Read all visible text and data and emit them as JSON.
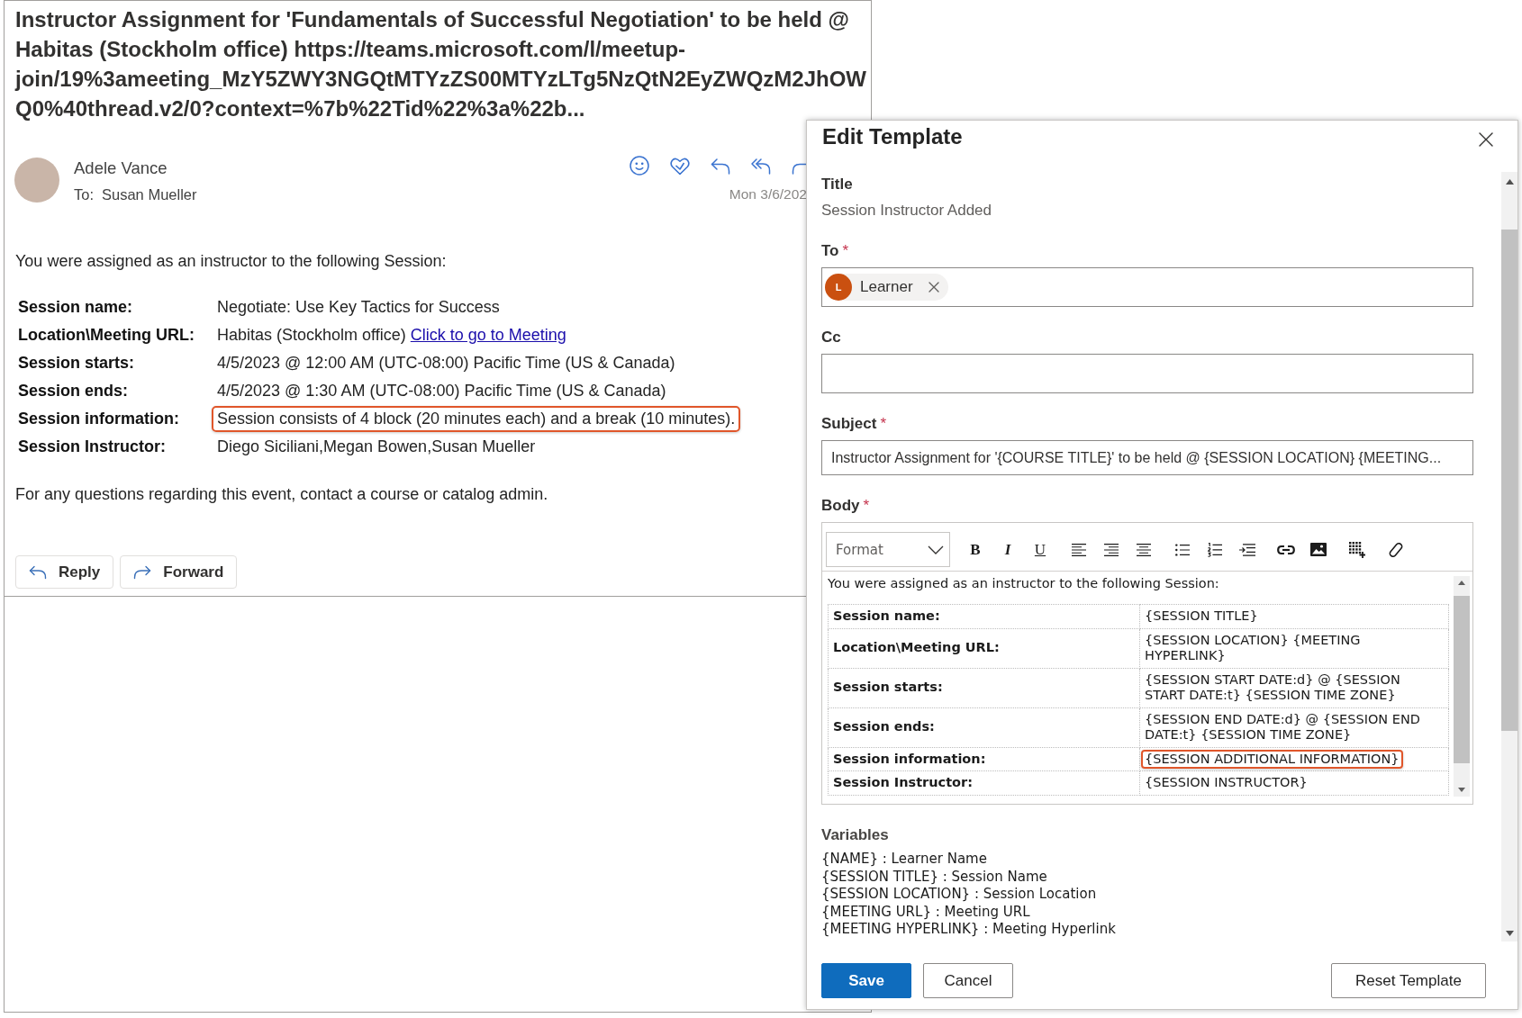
{
  "email": {
    "subject_lines": [
      "Instructor Assignment for 'Fundamentals of Successful Negotiation' to be held @",
      "Habitas (Stockholm office) https://teams.microsoft.com/l/meetup-",
      "join/19%3ameeting_MzY5ZWY3NGQtMTYzZS00MTYzLTg5NzQtN2EyZWQzM2JhOW",
      "Q0%40thread.v2/0?context=%7b%22Tid%22%3a%22b..."
    ],
    "sender": "Adele Vance",
    "to_label": "To:",
    "to": "Susan Mueller",
    "date": "Mon 3/6/202",
    "intro": "You were assigned as an instructor to the following Session:",
    "rows": [
      {
        "label": "Session name:",
        "value": "Negotiate: Use Key Tactics for Success",
        "highlighted": false
      },
      {
        "label": "Location\\Meeting URL:",
        "value": "Habitas (Stockholm office)",
        "link": "Click to go to Meeting",
        "highlighted": false
      },
      {
        "label": "Session starts:",
        "value": "4/5/2023 @ 12:00 AM (UTC-08:00) Pacific Time (US & Canada)",
        "highlighted": false
      },
      {
        "label": "Session ends:",
        "value": "4/5/2023 @ 1:30 AM (UTC-08:00) Pacific Time (US & Canada)",
        "highlighted": false
      },
      {
        "label": "Session information:",
        "value": "Session consists of 4 block (20 minutes each) and a break (10 minutes).",
        "highlighted": true
      },
      {
        "label": "Session Instructor:",
        "value": "Diego Siciliani,Megan Bowen,Susan Mueller",
        "highlighted": false
      }
    ],
    "closing": "For any questions regarding this event, contact a course or catalog admin.",
    "actions": [
      {
        "kind": "reply",
        "label": "Reply"
      },
      {
        "kind": "forward",
        "label": "Forward"
      }
    ]
  },
  "edit_template": {
    "title": "Edit Template",
    "title_field": {
      "label": "Title",
      "value": "Session Instructor Added"
    },
    "to": {
      "label": "To",
      "required_mark": "*",
      "recipients": [
        {
          "initials": "L",
          "name": "Learner"
        }
      ]
    },
    "cc": {
      "label": "Cc"
    },
    "subject": {
      "label": "Subject",
      "required_mark": "*",
      "value": "Instructor Assignment for '{COURSE TITLE}' to be held @ {SESSION LOCATION} {MEETING..."
    },
    "body": {
      "label": "Body",
      "required_mark": "*",
      "format": "Format",
      "toolbar": [
        {
          "kind": "bold",
          "glyph": "B"
        },
        {
          "kind": "italic",
          "glyph": "I"
        },
        {
          "kind": "underline",
          "glyph": "U"
        },
        {
          "kind": "align-left"
        },
        {
          "kind": "align-right"
        },
        {
          "kind": "align-center"
        },
        {
          "kind": "bullet-list"
        },
        {
          "kind": "numbered-list"
        },
        {
          "kind": "indent"
        },
        {
          "kind": "link"
        },
        {
          "kind": "image"
        },
        {
          "kind": "table"
        },
        {
          "kind": "eraser"
        }
      ],
      "intro": "You were assigned as an instructor to the following Session:",
      "rows": [
        {
          "label": "Session name:",
          "value": "{SESSION TITLE}",
          "highlighted": false
        },
        {
          "label": "Location\\Meeting URL:",
          "value": "{SESSION LOCATION} {MEETING HYPERLINK}",
          "highlighted": false
        },
        {
          "label": "Session starts:",
          "value": "{SESSION START DATE:d} @ {SESSION START DATE:t} {SESSION TIME ZONE}",
          "highlighted": false
        },
        {
          "label": "Session ends:",
          "value": "{SESSION END DATE:d} @ {SESSION END DATE:t} {SESSION TIME ZONE}",
          "highlighted": false
        },
        {
          "label": "Session information:",
          "value": "{SESSION ADDITIONAL INFORMATION}",
          "highlighted": true
        },
        {
          "label": "Session Instructor:",
          "value": "{SESSION INSTRUCTOR}",
          "highlighted": false
        }
      ]
    },
    "variables": {
      "label": "Variables",
      "items": [
        "{NAME} : Learner Name",
        "{SESSION TITLE} : Session Name",
        "{SESSION LOCATION} : Session Location",
        "{MEETING URL} : Meeting URL",
        "{MEETING HYPERLINK} : Meeting Hyperlink"
      ]
    },
    "buttons": [
      {
        "kind": "primary",
        "label": "Save"
      },
      {
        "kind": "default",
        "label": "Cancel"
      },
      {
        "kind": "default",
        "label": "Reset Template"
      }
    ]
  }
}
